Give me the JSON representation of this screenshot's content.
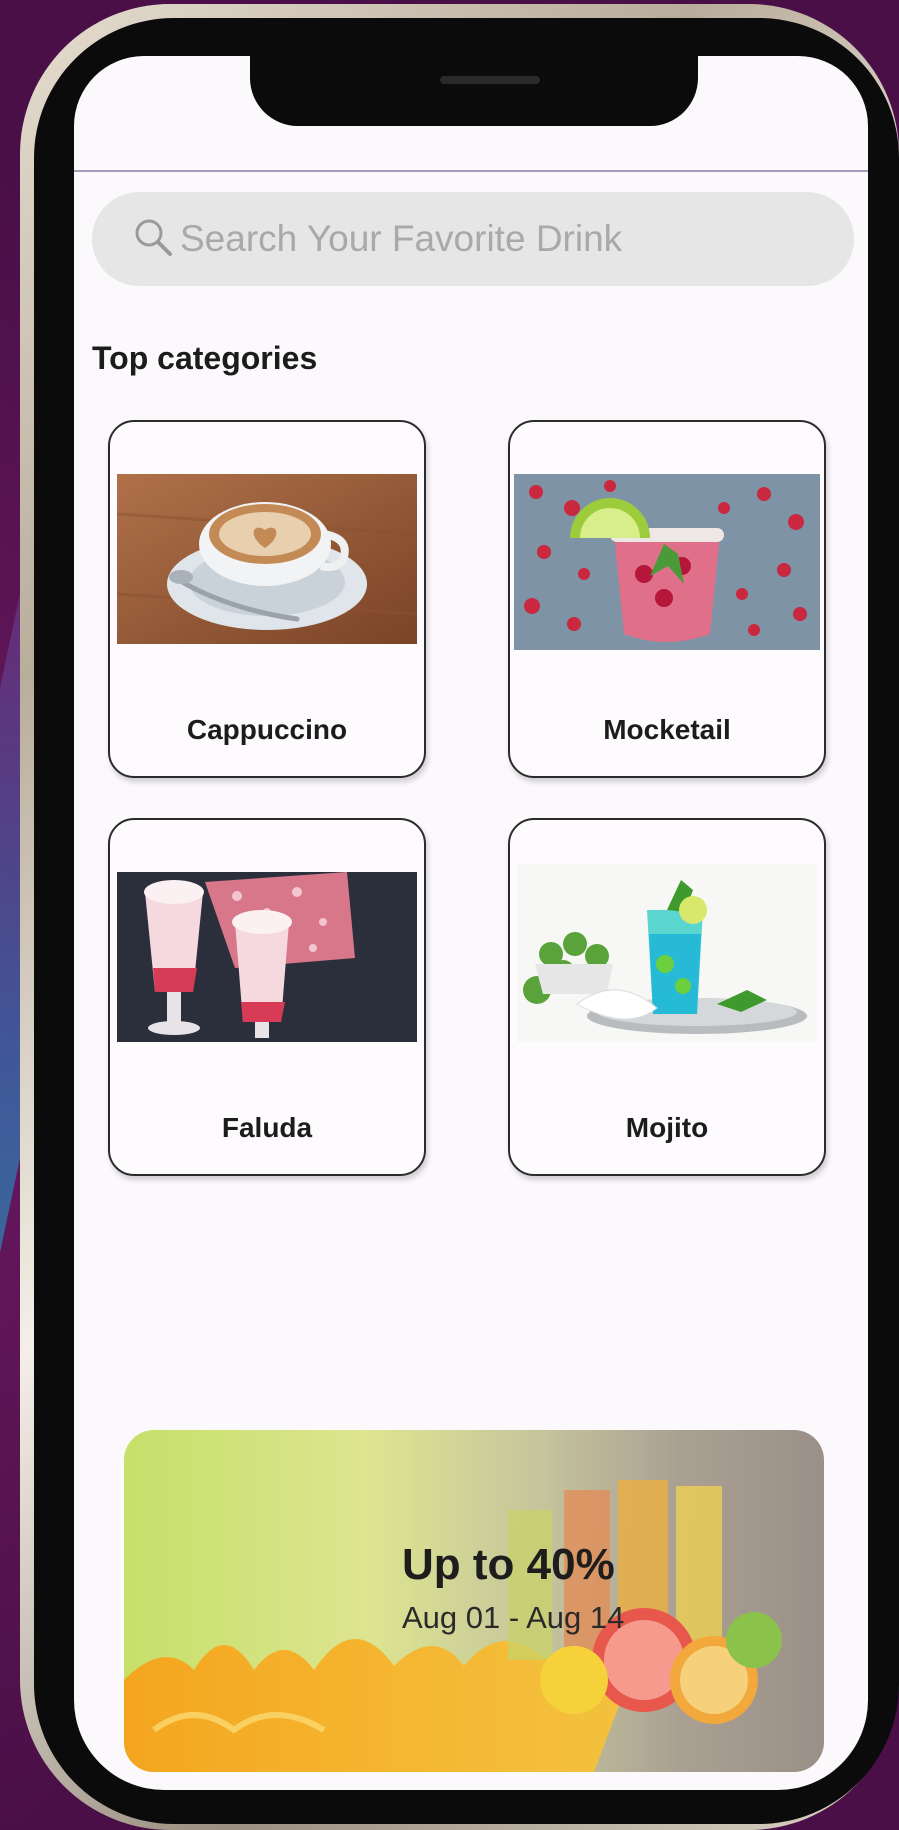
{
  "search": {
    "placeholder": "Search Your Favorite Drink",
    "icon": "search-icon"
  },
  "section_title": "Top categories",
  "categories": [
    {
      "label": "Cappuccino"
    },
    {
      "label": "Mocketail"
    },
    {
      "label": "Faluda"
    },
    {
      "label": "Mojito"
    }
  ],
  "promo": {
    "title": "Up to 40%",
    "dates": "Aug 01 - Aug 14"
  },
  "colors": {
    "screen_bg": "#fcf9fd",
    "search_bg": "#e6e6e6",
    "backdrop": "#4a0f46"
  }
}
